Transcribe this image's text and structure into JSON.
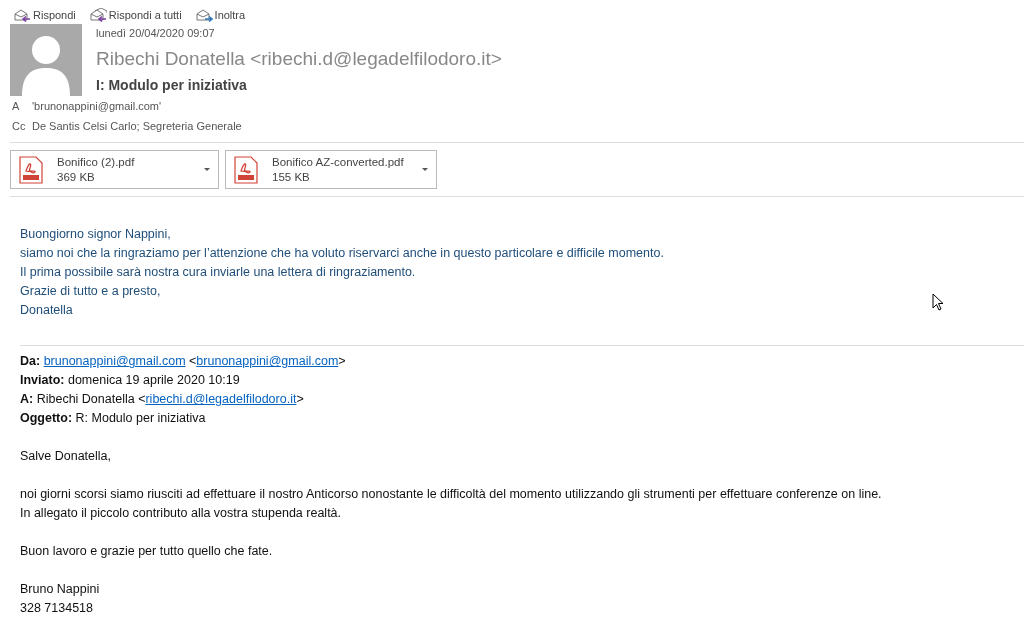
{
  "toolbar": [
    {
      "label": "Rispondi",
      "kind": "reply"
    },
    {
      "label": "Rispondi a tutti",
      "kind": "reply-all"
    },
    {
      "label": "Inoltra",
      "kind": "forward"
    }
  ],
  "message": {
    "date": "lunedì 20/04/2020 09:07",
    "sender": "Ribechi Donatella <ribechi.d@legadelfilodoro.it>",
    "subject": "I: Modulo per iniziativa",
    "recipients": [
      {
        "label": "A",
        "value": "'brunonappini@gmail.com'"
      },
      {
        "label": "Cc",
        "value": "De Santis Celsi Carlo; Segreteria Generale"
      }
    ]
  },
  "attachments": [
    {
      "name": "Bonifico (2).pdf",
      "size": "369 KB"
    },
    {
      "name": "Bonifico AZ-converted.pdf",
      "size": "155 KB"
    }
  ],
  "reply_lines": [
    "Buongiorno signor Nappini,",
    "siamo noi che la ringraziamo per l’attenzione che ha voluto riservarci anche in questo particolare e difficile momento.",
    "Il prima possibile sarà nostra cura inviarle una lettera di ringraziamento.",
    "Grazie di tutto e a presto,",
    "Donatella"
  ],
  "quoted_header": [
    {
      "label": "Da:",
      "parts": [
        {
          "text": "brunonappini@gmail.com",
          "link": true
        },
        {
          "text": " <"
        },
        {
          "text": "brunonappini@gmail.com",
          "link": true
        },
        {
          "text": ">"
        }
      ]
    },
    {
      "label": "Inviato:",
      "parts": [
        {
          "text": "domenica 19 aprile 2020 10:19"
        }
      ]
    },
    {
      "label": "A:",
      "parts": [
        {
          "text": "Ribechi Donatella <"
        },
        {
          "text": "ribechi.d@legadelfilodoro.it",
          "link": true
        },
        {
          "text": ">"
        }
      ]
    },
    {
      "label": "Oggetto:",
      "parts": [
        {
          "text": "R: Modulo per iniziativa"
        }
      ]
    }
  ],
  "quoted_body": [
    [
      "Salve Donatella,"
    ],
    [
      "noi giorni scorsi siamo riusciti ad effettuare il nostro Anticorso nonostante le difficoltà del momento utilizzando gli strumenti per effettuare conferenze on line.",
      "In allegato il piccolo contributo alla vostra stupenda realtà."
    ],
    [
      "Buon lavoro e grazie per tutto quello che fate."
    ],
    [
      "Bruno Nappini",
      "328 7134518"
    ]
  ]
}
